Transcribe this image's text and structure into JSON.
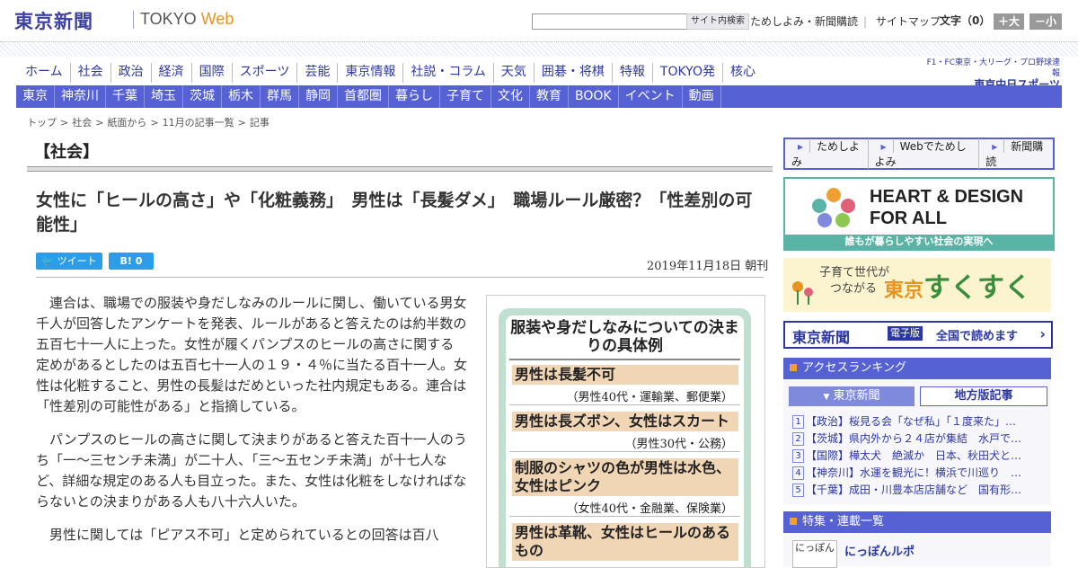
{
  "header": {
    "logo_ja": "東京新聞",
    "logo_tokyo": "TOKYO ",
    "logo_web": "Web",
    "search_button": "サイト内検索",
    "links": [
      "ためしよみ・新聞購読",
      "サイトマップ"
    ],
    "font_label": "文字（0）",
    "font_plus": "＋大",
    "font_minus": "－小"
  },
  "nav_main": [
    "ホーム",
    "社会",
    "政治",
    "経済",
    "国際",
    "スポーツ",
    "芸能",
    "東京情報",
    "社説・コラム",
    "天気",
    "囲碁・将棋",
    "特報",
    "TOKYO発",
    "核心"
  ],
  "chunichi": {
    "line1": "F1・FC東京・大リーグ・プロ野球速報",
    "line2": "東京中日スポーツ"
  },
  "nav_regional": [
    "東京",
    "神奈川",
    "千葉",
    "埼玉",
    "茨城",
    "栃木",
    "群馬",
    "静岡",
    "首都圏",
    "暮らし",
    "子育て",
    "文化",
    "教育",
    "BOOK",
    "イベント",
    "動画"
  ],
  "breadcrumb": [
    "トップ",
    ">",
    "社会",
    ">",
    "紙面から",
    ">",
    "11月の記事一覧",
    ">",
    "記事"
  ],
  "section_title": "【社会】",
  "article": {
    "headline": "女性に「ヒールの高さ」や「化粧義務」　男性は「長髪ダメ」　職場ルール厳密？「性差別の可能性」",
    "tweet_label": "ツイート",
    "hatena_label": "B! 0",
    "date": "2019年11月18日 朝刊",
    "paragraphs": [
      "連合は、職場での服装や身だしなみのルールに関し、働いている男女千人が回答したアンケートを発表、ルールがあると答えたのは約半数の五百七十一人に上った。女性が履くパンプスのヒールの高さに関する定めがあるとしたのは五百七十一人の１９・４％に当たる百十一人。女性は化粧すること、男性の長髪はだめといった社内規定もある。連合は「性差別の可能性がある」と指摘している。",
      "パンプスのヒールの高さに関して決まりがあると答えた百十一人のうち「一～三センチ未満」が二十人、「三～五センチ未満」が十七人など、詳細な規定のある人も目立った。また、女性は化粧をしなければならないとの決まりがある人も八十六人いた。",
      "男性に関しては「ピアス不可」と定められているとの回答は百八"
    ]
  },
  "figure": {
    "title": "服装や身だしなみについての決まりの具体例",
    "items": [
      {
        "rule": "男性は長髪不可",
        "source": "（男性40代・運輸業、郵便業）"
      },
      {
        "rule": "男性は長ズボン、女性はスカート",
        "source": "（男性30代・公務）"
      },
      {
        "rule": "制服のシャツの色が男性は水色、女性はピンク",
        "source": "（女性40代・金融業、保険業）"
      },
      {
        "rule": "男性は革靴、女性はヒールのあるもの",
        "source": ""
      }
    ]
  },
  "sidebar": {
    "trial_links": [
      "ためしよみ",
      "Webでためしよみ",
      "新聞購読"
    ],
    "heart_design": {
      "title_line1": "HEART & DESIGN",
      "title_line2": "FOR ALL",
      "caption": "誰もが暮らしやすい社会の実現へ"
    },
    "sukusuku": {
      "sub1": "子育て世代が",
      "sub2": "つながる",
      "main_a": "東京",
      "main_b": "すくすく"
    },
    "digital": {
      "logo": "東京新聞",
      "badge": "電子版",
      "text": "全国で読めます",
      "arrow": "›"
    },
    "ranking": {
      "title": "アクセスランキング",
      "tab_tokyo": "東京新聞",
      "tab_local": "地方版記事",
      "items": [
        {
          "num": "1",
          "text": "【政治】桜見る会「なぜ私」「１度来た」…"
        },
        {
          "num": "2",
          "text": "【茨城】県内外から２４店が集結　水戸で…"
        },
        {
          "num": "3",
          "text": "【国際】樺太犬　絶滅か　日本、秋田犬と…"
        },
        {
          "num": "4",
          "text": "【神奈川】水運を観光に！横浜で川巡り　…"
        },
        {
          "num": "5",
          "text": "【千葉】成田・川豊本店店舗など　国有形…"
        }
      ]
    },
    "features": {
      "title": "特集・連載一覧",
      "thumb": "にっぽん",
      "item": "にっぽんルポ"
    }
  },
  "colors": {
    "brand_blue": "#3d41a6",
    "nav_blue": "#5662d4",
    "accent_orange": "#e8931f",
    "figure_green": "#bfe0cf",
    "figure_item": "#f1d6b6"
  }
}
